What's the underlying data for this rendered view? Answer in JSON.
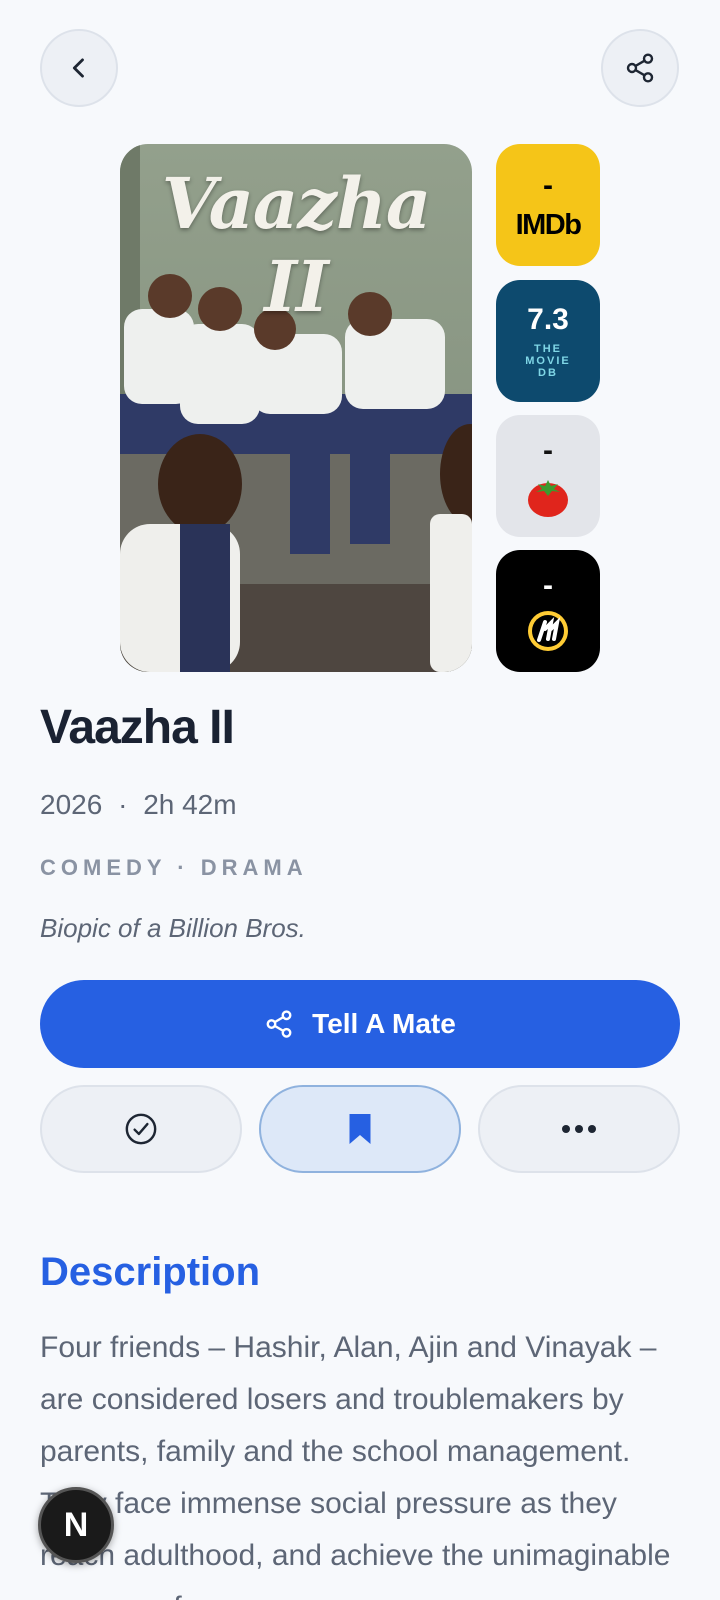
{
  "movie": {
    "title": "Vaazha II",
    "poster_text": "Vaazha II",
    "year": "2026",
    "separator": "·",
    "runtime": "2h 42m",
    "genres": "COMEDY · DRAMA",
    "tagline": "Biopic of a Billion Bros."
  },
  "ratings": {
    "imdb": {
      "score": "-",
      "logo": "IMDb"
    },
    "tmdb": {
      "score": "7.3",
      "logo_lines": [
        "THE",
        "MOVIE",
        "DB"
      ]
    },
    "rotten_tomatoes": {
      "score": "-",
      "icon": "tomato-icon"
    },
    "metacritic": {
      "score": "-",
      "icon": "metacritic-icon"
    }
  },
  "actions": {
    "tell_label": "Tell A Mate",
    "watched_icon": "check-circle-icon",
    "watchlist_icon": "bookmark-icon",
    "more_icon": "more-icon"
  },
  "description": {
    "heading": "Description",
    "text": "Four friends – Hashir, Alan, Ajin and Vinayak – are considered losers and troublemakers by parents, family and the school management. They face immense social pressure as they reach adulthood, and achieve the unimaginable success of"
  },
  "badge": {
    "label": "N"
  },
  "colors": {
    "accent": "#2660e2",
    "imdb": "#f5c518",
    "tmdb": "#0d4a6e",
    "background": "#f7f9fc"
  }
}
